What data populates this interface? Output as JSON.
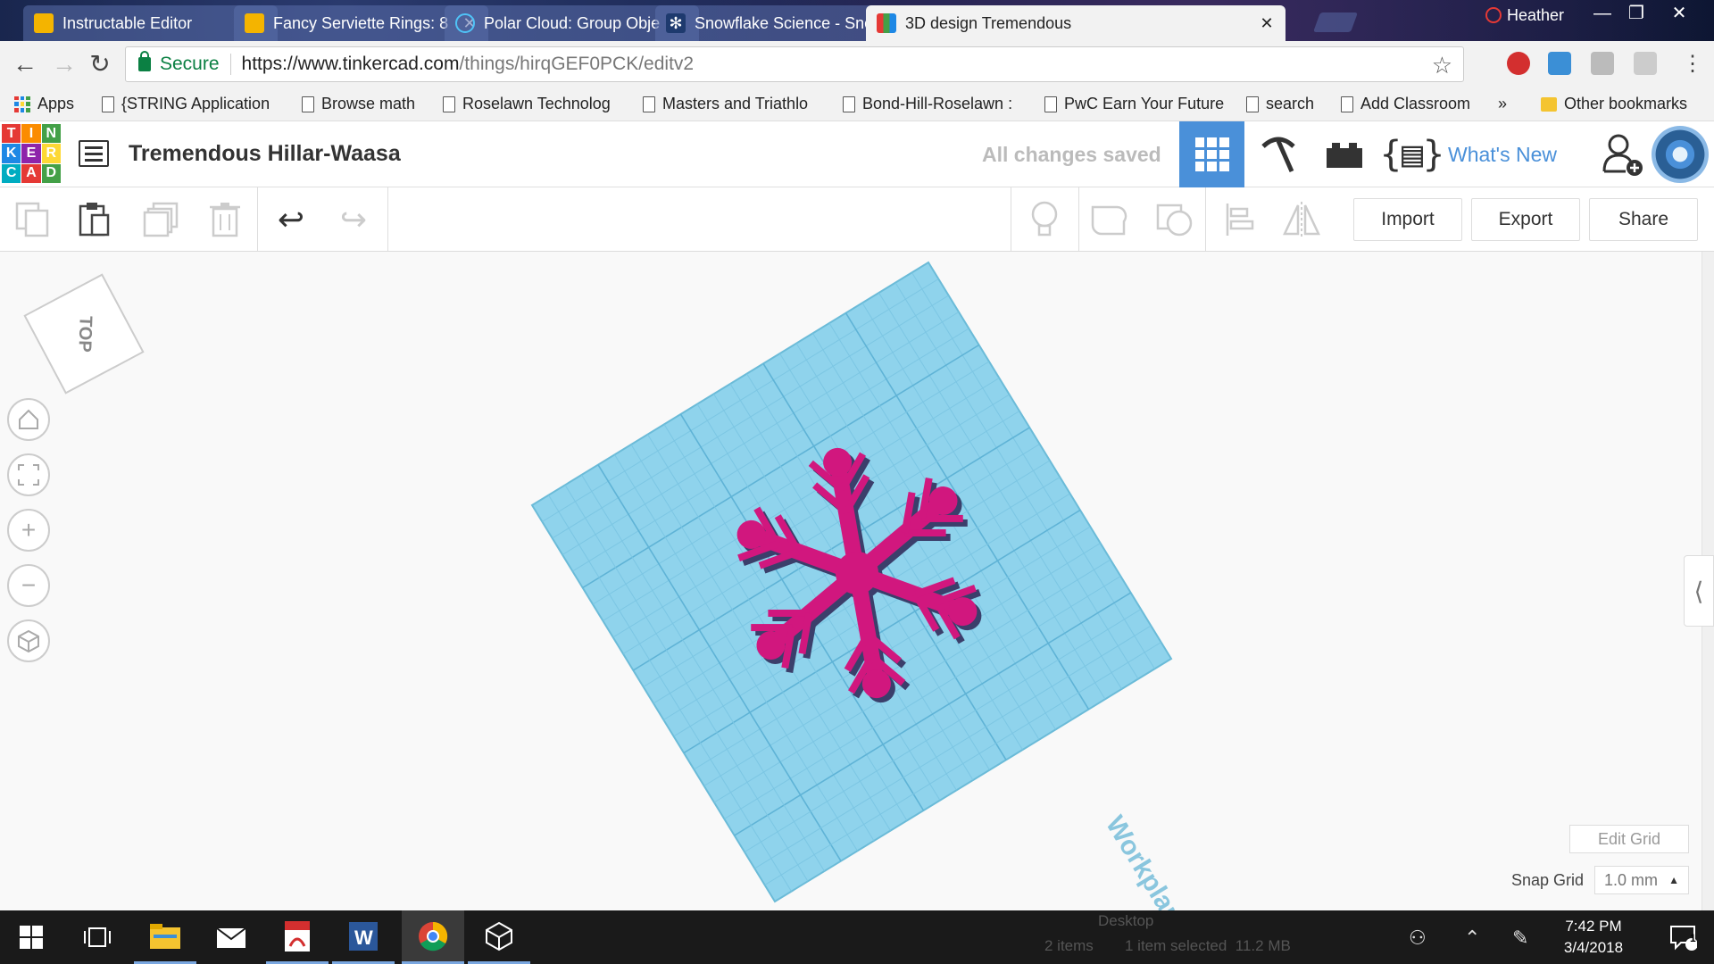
{
  "browser": {
    "tabs": [
      {
        "title": "Instructable Editor",
        "favicon": "instructables-robot-icon",
        "active": false
      },
      {
        "title": "Fancy Serviette Rings: 8",
        "favicon": "instructables-robot-icon",
        "active": false
      },
      {
        "title": "Polar Cloud: Group Obje",
        "favicon": "polar-cloud-icon",
        "active": false
      },
      {
        "title": "Snowflake Science - Sno",
        "favicon": "snowflake-icon",
        "active": false
      },
      {
        "title": "3D design Tremendous",
        "favicon": "tinkercad-icon",
        "active": true
      }
    ],
    "profile_name": "Heather",
    "security_label": "Secure",
    "url_host": "https://www.tinkercad.com",
    "url_path": "/things/hirqGEF0PCK/editv2",
    "bookmarks": [
      {
        "label": "Apps",
        "icon": "apps-grid-icon"
      },
      {
        "label": "{STRING Application",
        "icon": "page-icon"
      },
      {
        "label": "Browse math",
        "icon": "page-icon"
      },
      {
        "label": "Roselawn Technolog",
        "icon": "page-icon"
      },
      {
        "label": "Masters and Triathlo",
        "icon": "page-icon"
      },
      {
        "label": "Bond-Hill-Roselawn :",
        "icon": "page-icon"
      },
      {
        "label": "PwC Earn Your Future",
        "icon": "page-icon"
      },
      {
        "label": "search",
        "icon": "page-icon"
      },
      {
        "label": "Add Classroom",
        "icon": "page-icon"
      }
    ],
    "bookmarks_overflow": "»",
    "other_bookmarks": "Other bookmarks"
  },
  "tinkercad": {
    "logo_letters": [
      "T",
      "I",
      "N",
      "K",
      "E",
      "R",
      "C",
      "A",
      "D"
    ],
    "design_title": "Tremendous Hillar-Waasa",
    "save_status": "All changes saved",
    "whats_new": "What's New",
    "buttons": {
      "import": "Import",
      "export": "Export",
      "share": "Share"
    },
    "viewcube_face": "TOP",
    "workplane_label": "Workplane",
    "edit_grid": "Edit Grid",
    "snap_grid_label": "Snap Grid",
    "snap_grid_value": "1.0 mm",
    "collapse_handle": "⟨"
  },
  "taskbar": {
    "time": "7:42 PM",
    "date": "3/4/2018",
    "notification_count": "1",
    "explorer_ghost": {
      "location": "Desktop",
      "items": "2 items",
      "selection": "1 item selected  11.2 MB"
    }
  },
  "colors": {
    "tinkercad_blue": "#4a90d9",
    "workplane": "#8fd3ec",
    "snowflake": "#d1177e",
    "logo": [
      "#e53935",
      "#fb8c00",
      "#43a047",
      "#1e88e5",
      "#8e24aa",
      "#fdd835",
      "#00acc1",
      "#e53935",
      "#43a047"
    ]
  }
}
